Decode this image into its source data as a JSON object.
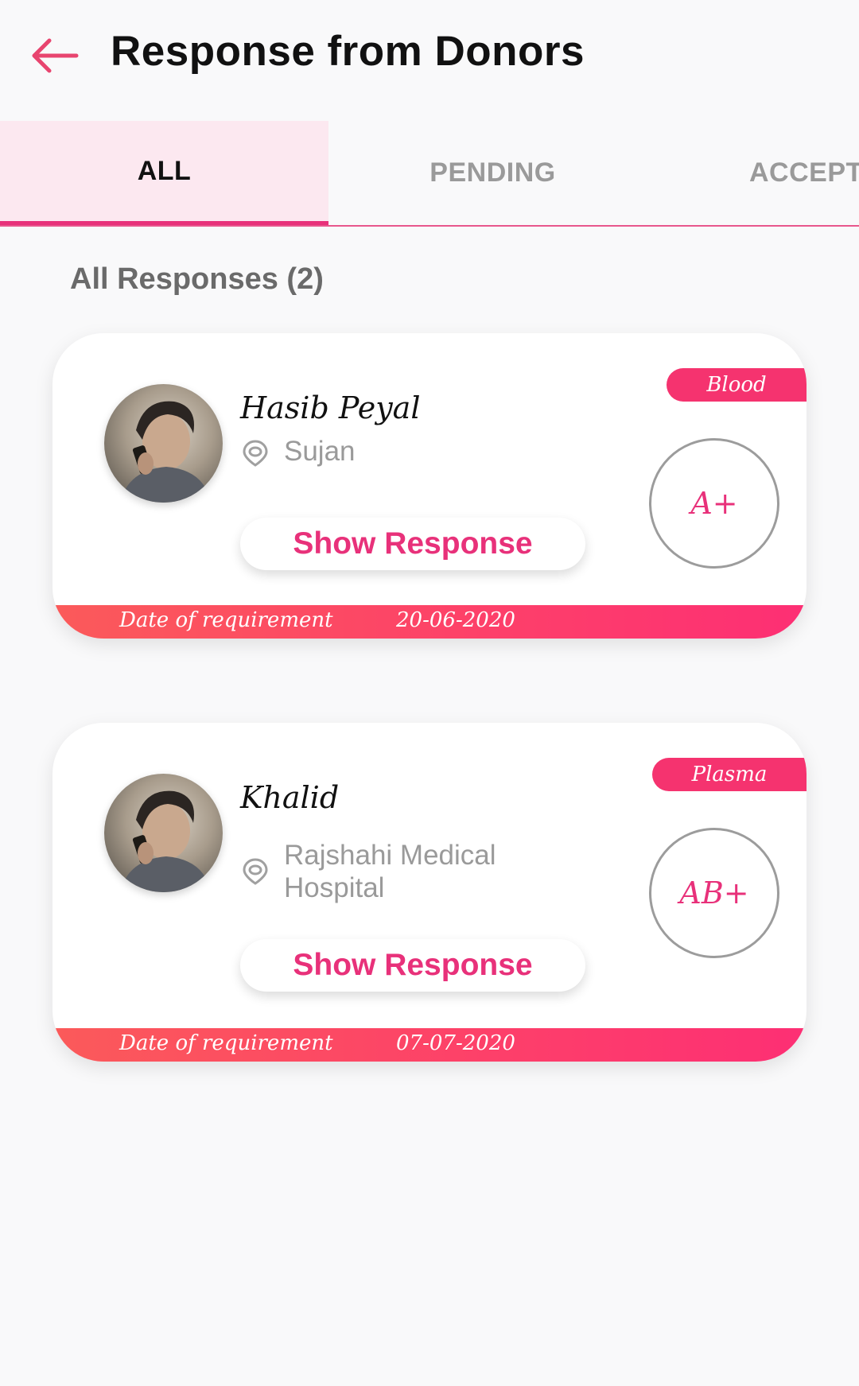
{
  "header": {
    "title": "Response from Donors",
    "accent_color": "#e8317a"
  },
  "tabs": [
    {
      "label": "ALL",
      "active": true
    },
    {
      "label": "PENDING",
      "active": false
    },
    {
      "label": "ACCEPTED",
      "active": false
    }
  ],
  "section": {
    "title": "All Responses (2)"
  },
  "cards": [
    {
      "name": "Hasib Peyal",
      "location": "Sujan",
      "button_label": "Show Response",
      "type": "Blood",
      "blood_group": "A+",
      "date_label": "Date of requirement",
      "date": "20-06-2020"
    },
    {
      "name": "Khalid",
      "location": "Rajshahi Medical Hospital",
      "button_label": "Show Response",
      "type": "Plasma",
      "blood_group": "AB+",
      "date_label": "Date of requirement",
      "date": "07-07-2020"
    }
  ],
  "icons": {
    "back": "arrow-left-icon",
    "location": "location-pin-icon"
  }
}
